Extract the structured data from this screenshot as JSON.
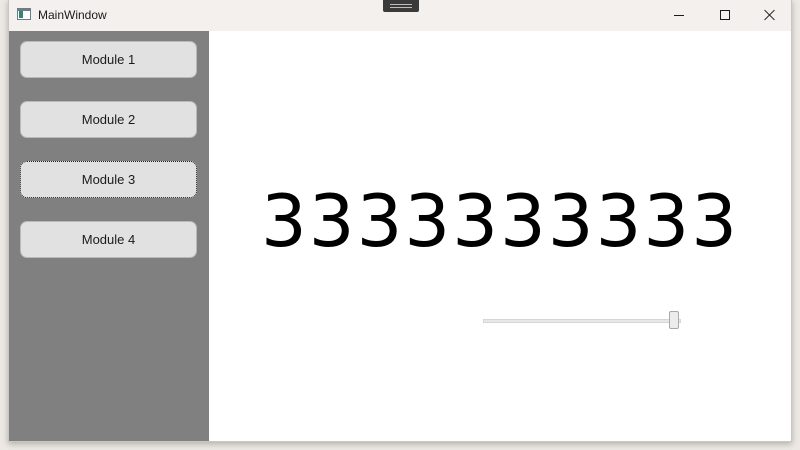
{
  "window": {
    "title": "MainWindow",
    "icon": "window-app-icon",
    "controls": {
      "minimize": "minimize-icon",
      "maximize": "maximize-icon",
      "close": "close-icon"
    }
  },
  "sidebar": {
    "background": "#808080",
    "buttons": [
      {
        "label": "Module 1"
      },
      {
        "label": "Module 2"
      },
      {
        "label": "Module 3",
        "focused": true
      },
      {
        "label": "Module 4"
      }
    ]
  },
  "main": {
    "display_text": "3333333333",
    "slider": {
      "value_fraction": 1.0
    }
  }
}
